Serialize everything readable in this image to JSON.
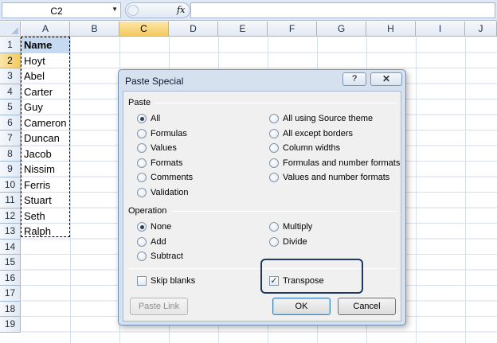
{
  "formula_bar": {
    "name_box_value": "C2",
    "name_box_arrow": "▼",
    "fx_label": "fx",
    "formula_value": ""
  },
  "columns": [
    "A",
    "B",
    "C",
    "D",
    "E",
    "F",
    "G",
    "H",
    "I",
    "J"
  ],
  "selected_column": "C",
  "rows": [
    "1",
    "2",
    "3",
    "4",
    "5",
    "6",
    "7",
    "8",
    "9",
    "10",
    "11",
    "12",
    "13",
    "14",
    "15",
    "16",
    "17",
    "18",
    "19"
  ],
  "column_a_cells": [
    "Name",
    "Hoyt",
    "Abel",
    "Carter",
    "Guy",
    "Cameron",
    "Duncan",
    "Jacob",
    "Nissim",
    "Ferris",
    "Stuart",
    "Seth",
    "Ralph"
  ],
  "dialog": {
    "title": "Paste Special",
    "help_glyph": "?",
    "close_glyph": "✕",
    "paste": {
      "label": "Paste",
      "options_left": [
        "All",
        "Formulas",
        "Values",
        "Formats",
        "Comments",
        "Validation"
      ],
      "options_right": [
        "All using Source theme",
        "All except borders",
        "Column widths",
        "Formulas and number formats",
        "Values and number formats"
      ],
      "selected": "All"
    },
    "operation": {
      "label": "Operation",
      "options_left": [
        "None",
        "Add",
        "Subtract"
      ],
      "options_right": [
        "Multiply",
        "Divide"
      ],
      "selected": "None"
    },
    "skip_blanks": {
      "label": "Skip blanks",
      "checked": false
    },
    "transpose": {
      "label": "Transpose",
      "checked": true,
      "check_glyph": "✓"
    },
    "buttons": {
      "paste_link": "Paste Link",
      "ok": "OK",
      "cancel": "Cancel"
    }
  },
  "colors": {
    "highlight_box": "#1f3864",
    "header_selected": "#f4c95f",
    "name_cell_fill": "#c5d9f1"
  }
}
